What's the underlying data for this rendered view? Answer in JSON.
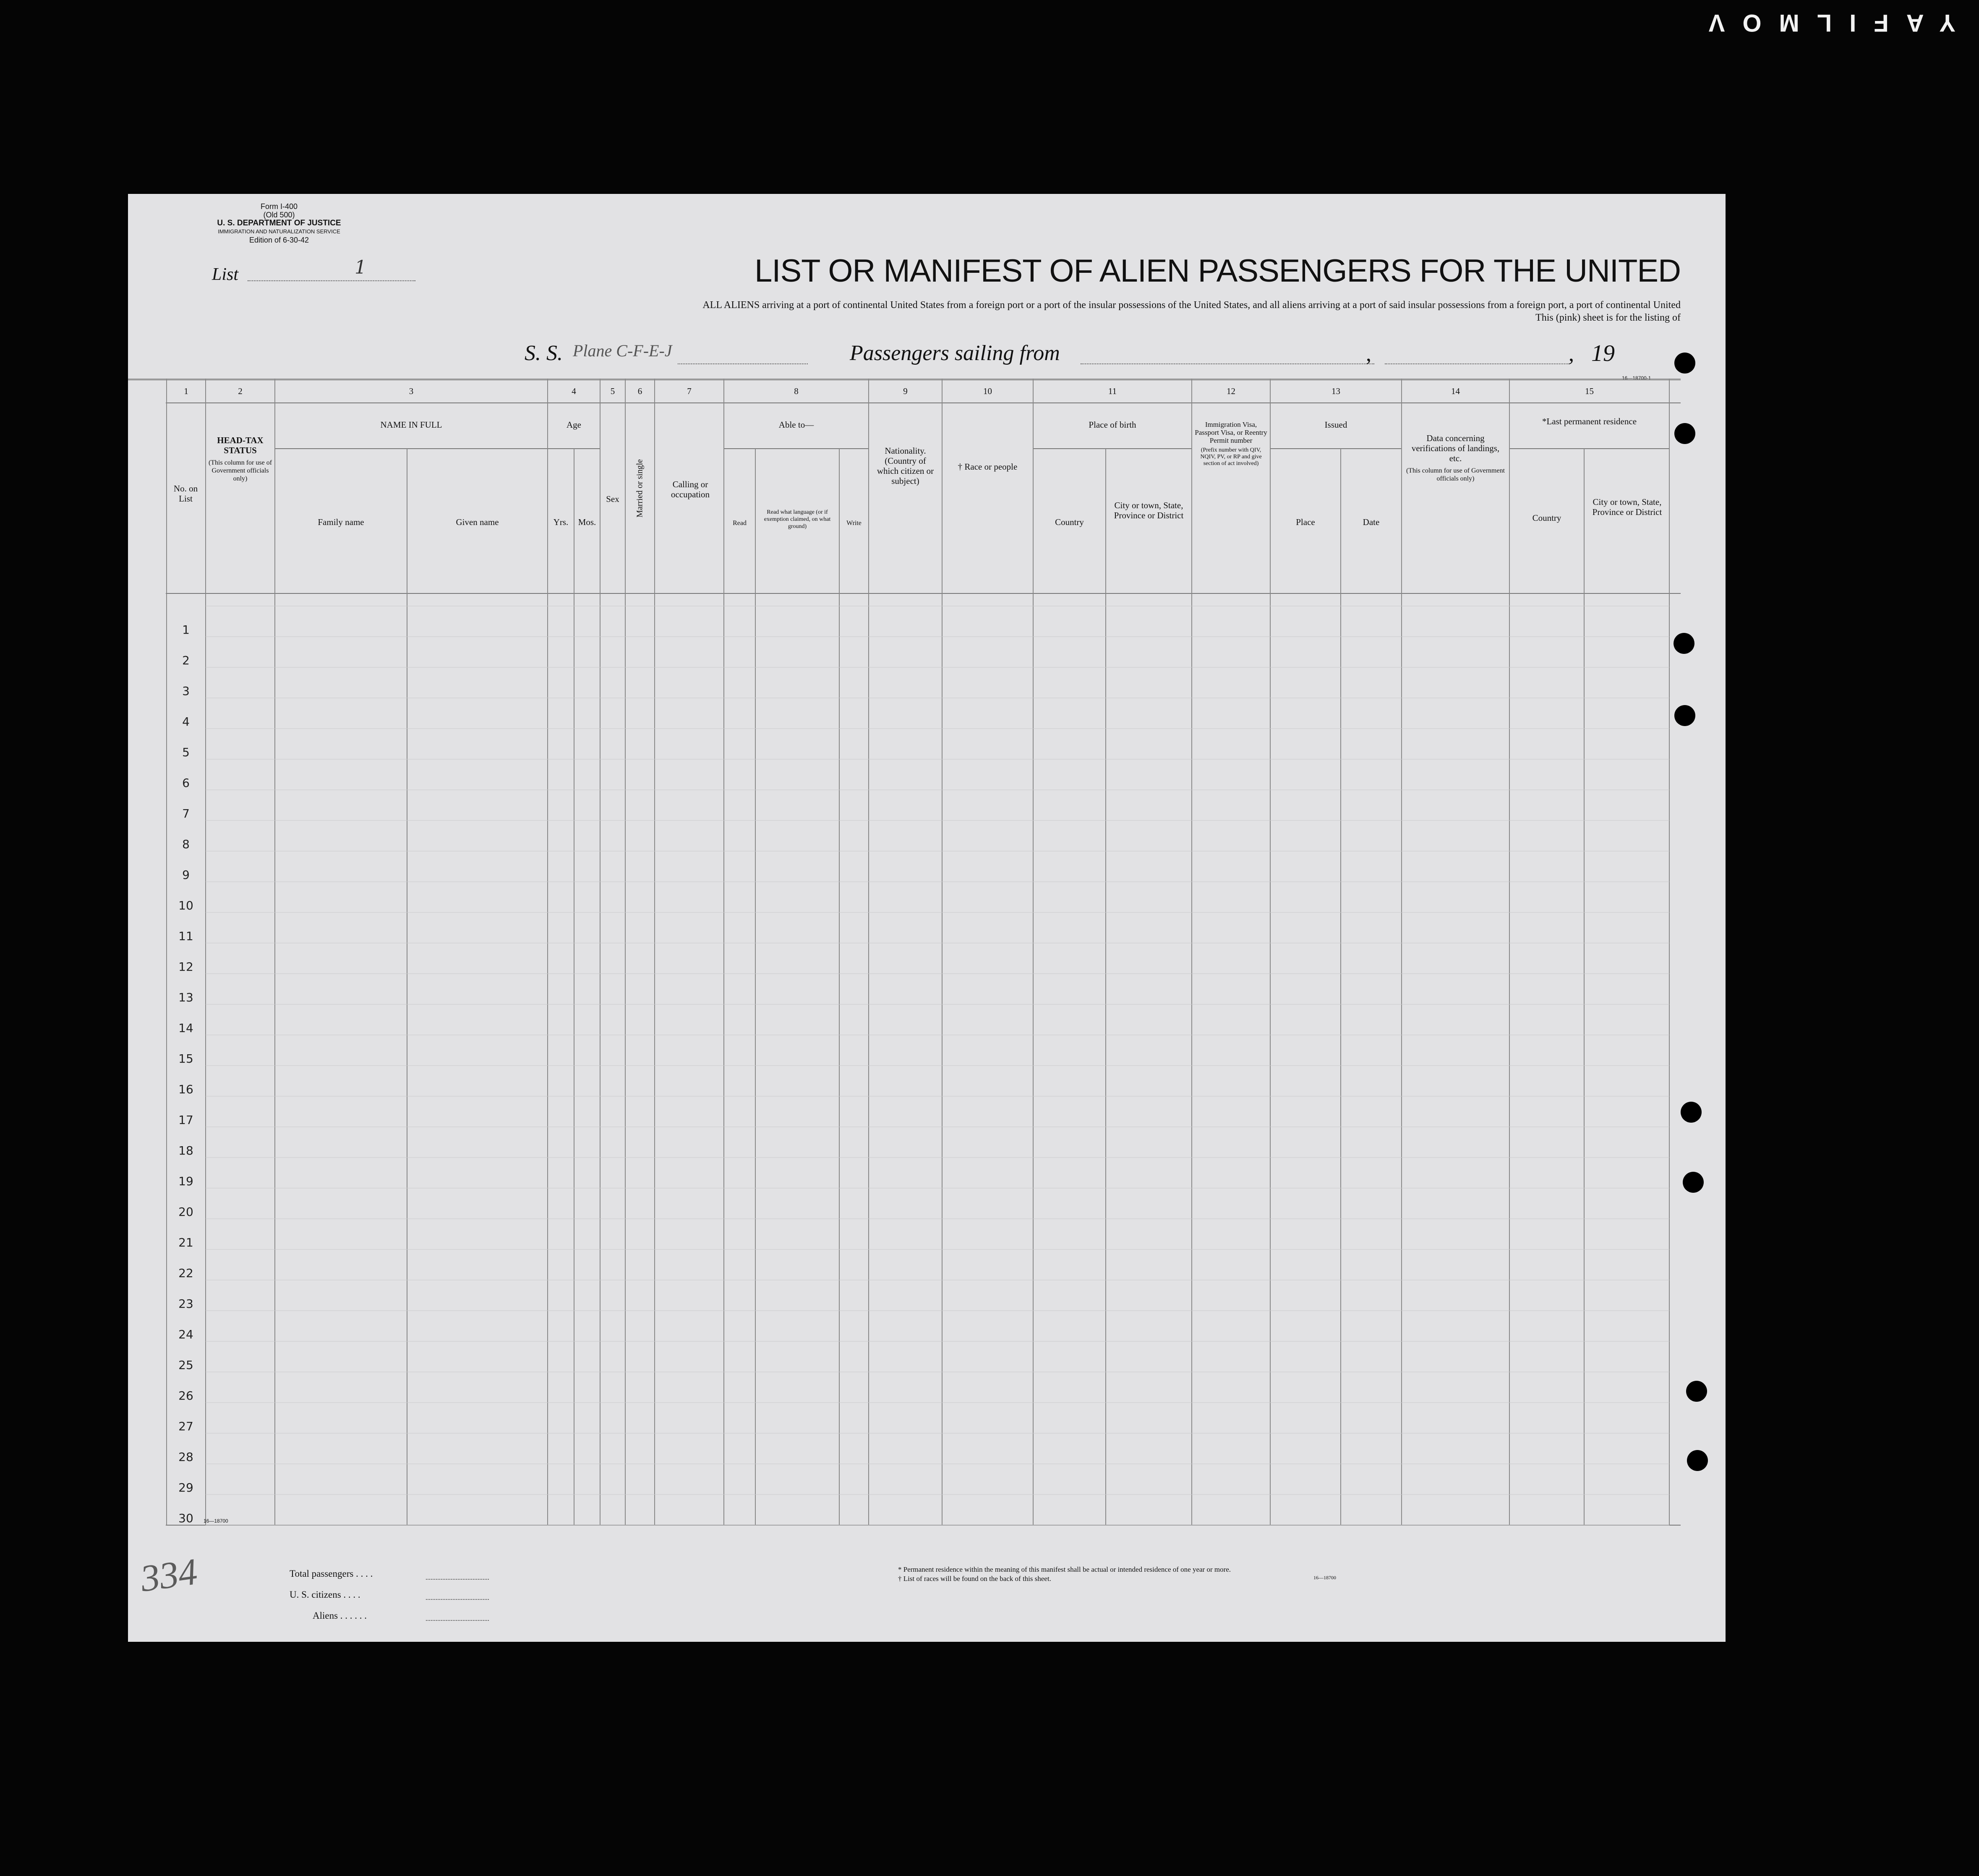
{
  "film_label": "YAFILMOV",
  "form": {
    "number": "Form I-400",
    "old": "(Old 500)",
    "department": "U. S. DEPARTMENT OF JUSTICE",
    "service": "IMMIGRATION AND NATURALIZATION SERVICE",
    "edition": "Edition of 6-30-42",
    "list_label": "List",
    "list_value": "1",
    "title": "LIST OR MANIFEST OF ALIEN PASSENGERS FOR THE UNITED",
    "subtitle": "ALL ALIENS arriving at a port of continental United States from a foreign port or a port of the insular possessions of the United States, and all aliens arriving at a port of said insular possessions from a foreign port, a port of continental United",
    "subtitle2": "This (pink) sheet is for the listing of",
    "ss_label": "S. S.",
    "ss_value": "Plane C-F-E-J",
    "sailing_label": "Passengers sailing from",
    "comma": ",",
    "year_prefix": "19",
    "small_code": "16—18700-1"
  },
  "columns": {
    "numbers": [
      "1",
      "2",
      "3",
      "4",
      "5",
      "6",
      "7",
      "8",
      "9",
      "10",
      "11",
      "12",
      "13",
      "14",
      "15"
    ],
    "no_on_list": "No. on List",
    "head_tax": "HEAD-TAX STATUS",
    "head_tax_note": "(This column for use of Government officials only)",
    "name_in_full": "NAME IN FULL",
    "family_name": "Family name",
    "given_name": "Given name",
    "age": "Age",
    "yrs": "Yrs.",
    "mos": "Mos.",
    "sex": "Sex",
    "married": "Married or single",
    "calling": "Calling or occupation",
    "able_to": "Able to—",
    "read": "Read",
    "read_language": "Read what language (or if exemption claimed, on what ground)",
    "write": "Write",
    "nationality": "Nationality. (Country of which citizen or subject)",
    "race": "† Race or people",
    "place_of_birth": "Place of birth",
    "country": "Country",
    "city_birth": "City or town, State, Province or District",
    "visa": "Immigration Visa, Passport Visa, or Reentry Permit number",
    "visa_note": "(Prefix number with QIV, NQIV, PV, or RP and give section of act involved)",
    "issued": "Issued",
    "place": "Place",
    "date": "Date",
    "data_concerning": "Data concerning verifications of landings, etc.",
    "data_note": "(This column for use of Government officials only)",
    "last_residence": "*Last permanent residence",
    "res_country": "Country",
    "res_city": "City or town, State, Province or District"
  },
  "rows": [
    "1",
    "2",
    "3",
    "4",
    "5",
    "6",
    "7",
    "8",
    "9",
    "10",
    "11",
    "12",
    "13",
    "14",
    "15",
    "16",
    "17",
    "18",
    "19",
    "20",
    "21",
    "22",
    "23",
    "24",
    "25",
    "26",
    "27",
    "28",
    "29",
    "30"
  ],
  "bottom_code": "16—18700",
  "totals": {
    "total_passengers": "Total passengers . . . .",
    "us_citizens": "U. S. citizens . . . .",
    "aliens": "Aliens . . . . . ."
  },
  "footnotes": {
    "permanent": "* Permanent residence within the meaning of this manifest shall be actual or intended residence of one year or more.",
    "races": "† List of races will be found on the back of this sheet.",
    "code": "16—18700"
  },
  "margin_scrawl": "334"
}
